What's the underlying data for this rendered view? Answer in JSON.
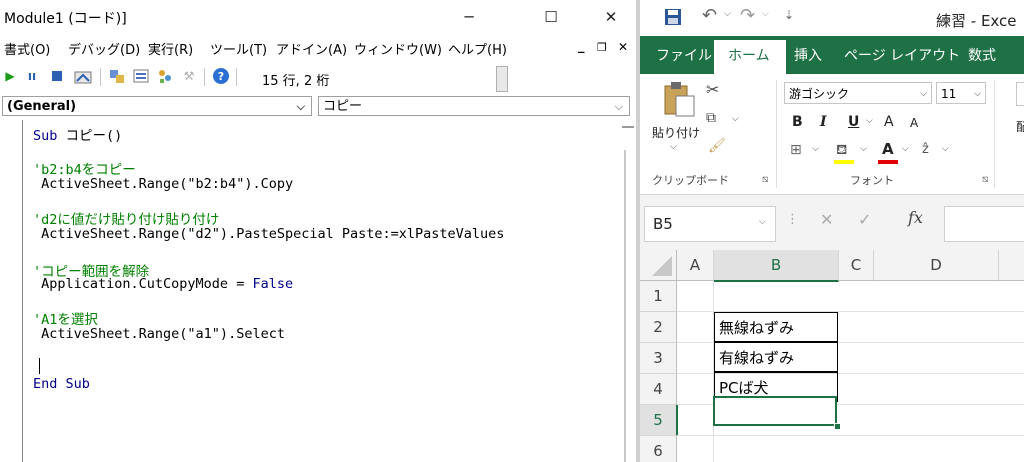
{
  "vbe": {
    "title": "Module1 (コード)]",
    "win_min": "─",
    "win_max": "☐",
    "win_close": "✕",
    "menu": [
      "書式(O)",
      "デバッグ(D)",
      "実行(R)",
      "ツール(T)",
      "アドイン(A)",
      "ウィンドウ(W)",
      "ヘルプ(H)"
    ],
    "menu_min": "_",
    "menu_restore": "❐",
    "menu_close": "✕",
    "toolbar_position": "15 行, 2 桁",
    "object_combo": "(General)",
    "proc_combo": "コピー",
    "code": [
      {
        "text": "Sub コピー()",
        "kind": "mixed",
        "kw": "Sub ",
        "rest": "コピー()"
      },
      {
        "text": "'b2:b4をコピー",
        "kind": "comment"
      },
      {
        "text": " ActiveSheet.Range(\"b2:b4\").Copy",
        "kind": "code"
      },
      {
        "text": "'d2に値だけ貼り付け貼り付け",
        "kind": "comment"
      },
      {
        "text": " ActiveSheet.Range(\"d2\").PasteSpecial Paste:=xlPasteValues",
        "kind": "code"
      },
      {
        "text": "'コピー範囲を解除",
        "kind": "comment"
      },
      {
        "text": " Application.CutCopyMode = False",
        "kind": "code"
      },
      {
        "text": "'A1を選択",
        "kind": "comment"
      },
      {
        "text": " ActiveSheet.Range(\"a1\").Select",
        "kind": "code"
      },
      {
        "text": "End Sub",
        "kind": "keyword"
      }
    ]
  },
  "excel": {
    "title": "練習 - Exce",
    "tabs": [
      "ファイル",
      "ホーム",
      "挿入",
      "ページ レイアウト",
      "数式"
    ],
    "active_tab": "ホーム",
    "paste_label": "貼り付け",
    "clipboard_group": "クリップボード",
    "font_name": "游ゴシック",
    "font_size": "11",
    "font_group": "フォント",
    "bold": "B",
    "italic": "I",
    "underline": "U",
    "grow_font": "A",
    "shrink_font": "A",
    "font_color": "A",
    "name_box": "B5",
    "fx": "fx",
    "columns": [
      "A",
      "B",
      "C",
      "D"
    ],
    "rows": [
      "1",
      "2",
      "3",
      "4",
      "5",
      "6"
    ],
    "cells": {
      "B2": "無線ねずみ",
      "B3": "有線ねずみ",
      "B4": "PCば犬"
    },
    "selected_cell": "B5",
    "accent": "#1e7145"
  }
}
